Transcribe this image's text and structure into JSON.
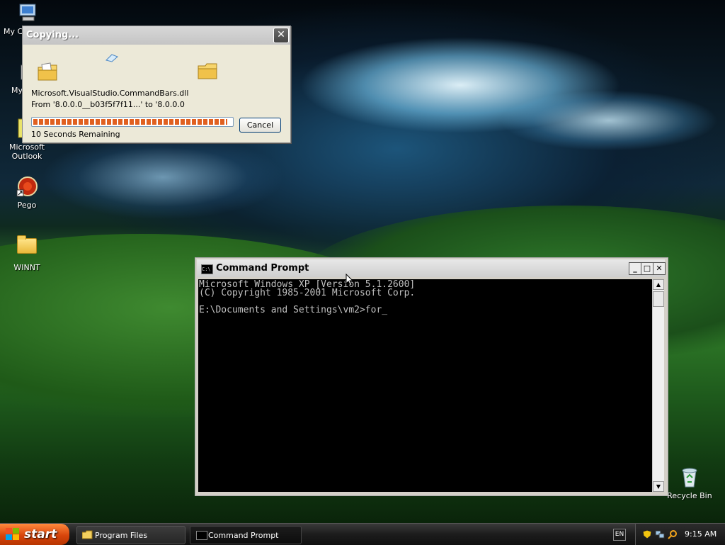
{
  "desktop": {
    "icons": [
      {
        "label": "My C",
        "icon": "computer-icon"
      },
      {
        "label": "My",
        "icon": "documents-icon"
      },
      {
        "label": "Microsoft Outlook",
        "icon": "outlook-icon"
      },
      {
        "label": "Pego",
        "icon": "pego-icon"
      },
      {
        "label": "WINNT",
        "icon": "folder-icon"
      },
      {
        "label": "Recycle Bin",
        "icon": "recycle-bin-icon"
      }
    ]
  },
  "copy_dialog": {
    "title": "Copying...",
    "filename": "Microsoft.VisualStudio.CommandBars.dll",
    "from_to": "From '8.0.0.0__b03f5f7f11...' to '8.0.0.0",
    "progress_fraction": 0.98,
    "remaining": "10 Seconds Remaining",
    "cancel_label": "Cancel",
    "close_glyph": "✕"
  },
  "cmd_window": {
    "title": "Command Prompt",
    "icon_text": "C:\\",
    "minimize_glyph": "_",
    "maximize_glyph": "□",
    "close_glyph": "✕",
    "lines": [
      "Microsoft Windows XP [Version 5.1.2600]",
      "(C) Copyright 1985-2001 Microsoft Corp.",
      "",
      "E:\\Documents and Settings\\vm2>for_"
    ]
  },
  "taskbar": {
    "start_label": "start",
    "buttons": [
      {
        "label": "Program Files",
        "icon": "folder-icon"
      },
      {
        "label": "Command Prompt",
        "icon": "cmd-icon"
      }
    ],
    "language": "EN",
    "clock": "9:15 AM"
  },
  "colors": {
    "progress": "#e06020",
    "start": "#d8450c",
    "console_bg": "#000000",
    "console_fg": "#c0c0c0"
  }
}
